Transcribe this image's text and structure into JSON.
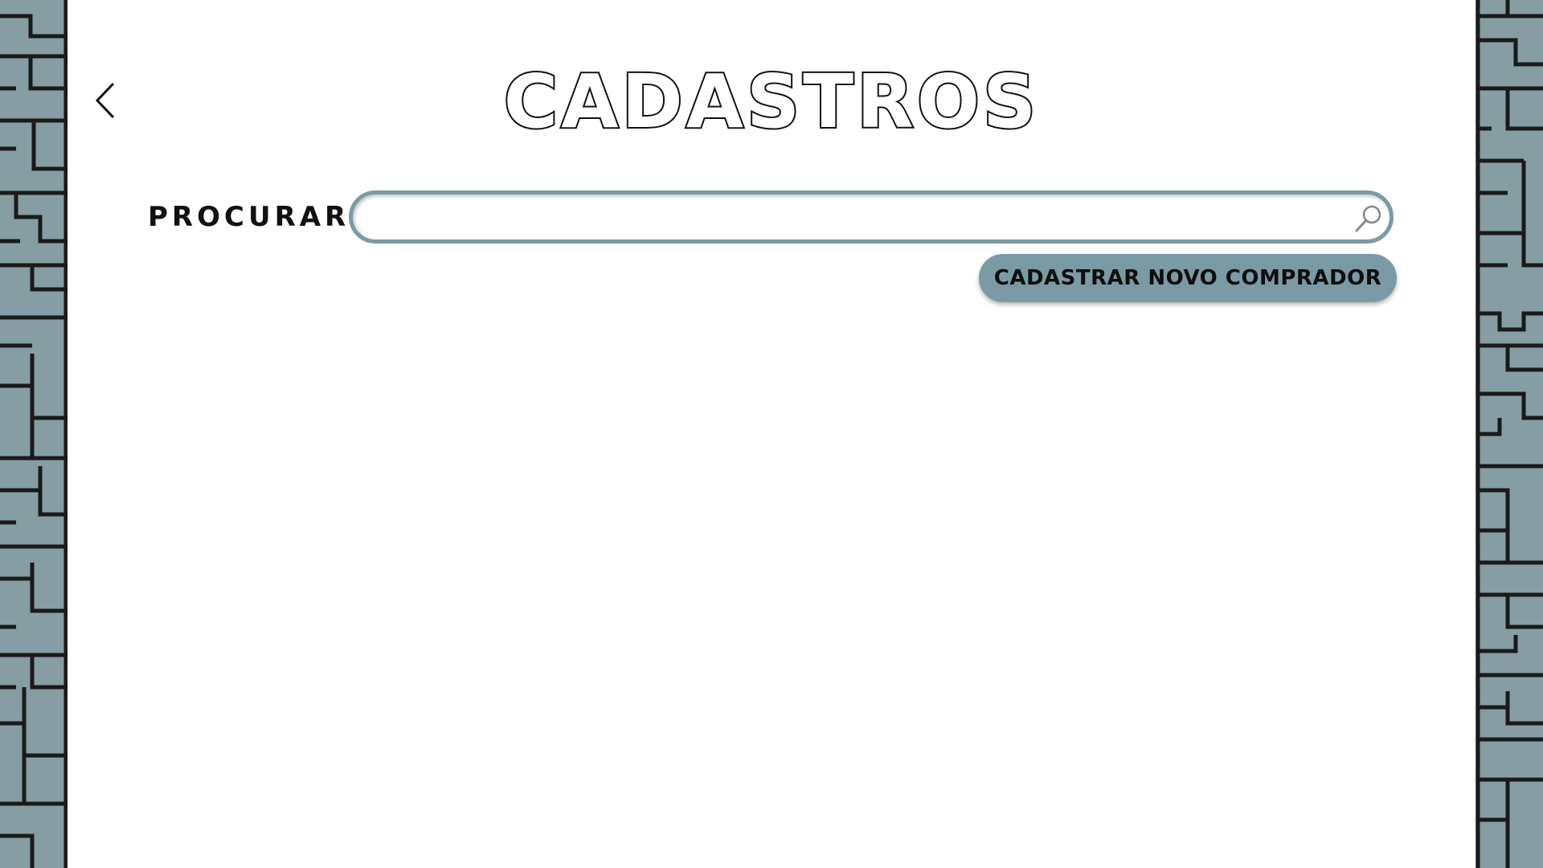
{
  "header": {
    "title": "CADASTROS",
    "back_icon": "chevron-left-icon"
  },
  "search": {
    "label": "PROCURAR:",
    "value": "",
    "placeholder": "",
    "icon": "search-icon"
  },
  "actions": {
    "new_buyer_label": "CADASTRAR NOVO COMPRADOR"
  },
  "colors": {
    "accent": "#7a9ba6",
    "border_pattern_fill": "#869da3",
    "border_pattern_line": "#1a1a1a",
    "text": "#111111",
    "background": "#ffffff"
  }
}
